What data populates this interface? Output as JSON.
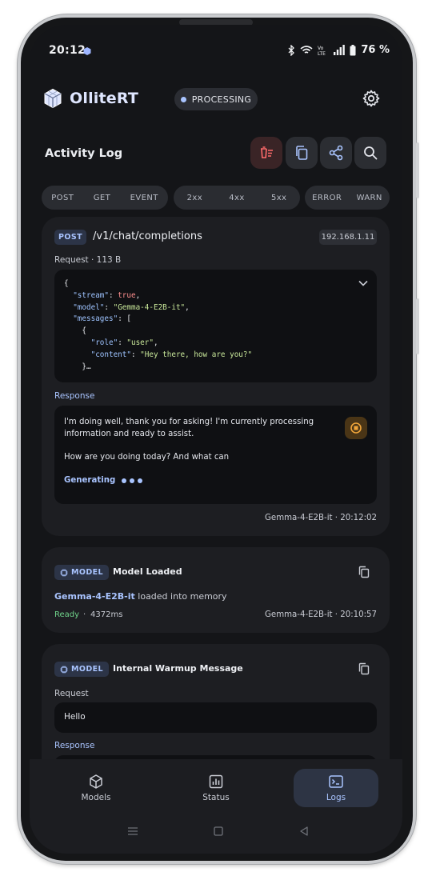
{
  "statusbar": {
    "time": "20:12",
    "battery": "76 %"
  },
  "app": {
    "title": "OlliteRT",
    "status": "PROCESSING"
  },
  "log": {
    "title": "Activity Log"
  },
  "filters": {
    "methods": [
      "POST",
      "GET",
      "EVENT"
    ],
    "codes": [
      "2xx",
      "4xx",
      "5xx"
    ],
    "levels": [
      "ERROR",
      "WARN"
    ]
  },
  "request_card": {
    "method": "POST",
    "endpoint": "/v1/chat/completions",
    "ip": "192.168.1.11",
    "request_label": "Request · 113 B",
    "code": {
      "l1": "{",
      "l2_key": "\"stream\"",
      "l2_val": "true",
      "l3_key": "\"model\"",
      "l3_val": "\"Gemma-4-E2B-it\"",
      "l4_key": "\"messages\"",
      "l4_rest": ": [",
      "l5": "{",
      "l6_key": "\"role\"",
      "l6_val": "\"user\"",
      "l7_key": "\"content\"",
      "l7_val": "\"Hey there, how are you?\"",
      "l8": "}…"
    },
    "response_label": "Response",
    "response_line1": "I'm doing well, thank you for asking! I'm currently processing information and ready to assist.",
    "response_line2": "How are you doing today? And what can",
    "generating": "Generating",
    "meta": "Gemma-4-E2B-it · 20:12:02"
  },
  "model_card": {
    "chip": "MODEL",
    "title": "Model Loaded",
    "model_name": "Gemma-4-E2B-it",
    "loaded_text": "loaded into memory",
    "ready": "Ready",
    "sep": "·",
    "duration": "4372ms",
    "meta": "Gemma-4-E2B-it · 20:10:57"
  },
  "warmup_card": {
    "chip": "MODEL",
    "title": "Internal Warmup Message",
    "request_label": "Request",
    "request_text": "Hello",
    "response_label": "Response"
  },
  "nav": {
    "models": "Models",
    "status": "Status",
    "logs": "Logs"
  },
  "colors": {
    "accent": "#a9c4ff",
    "background": "#141518",
    "card": "#1d1e22",
    "ready": "#6fd28a",
    "danger": "#ff6b6b"
  }
}
